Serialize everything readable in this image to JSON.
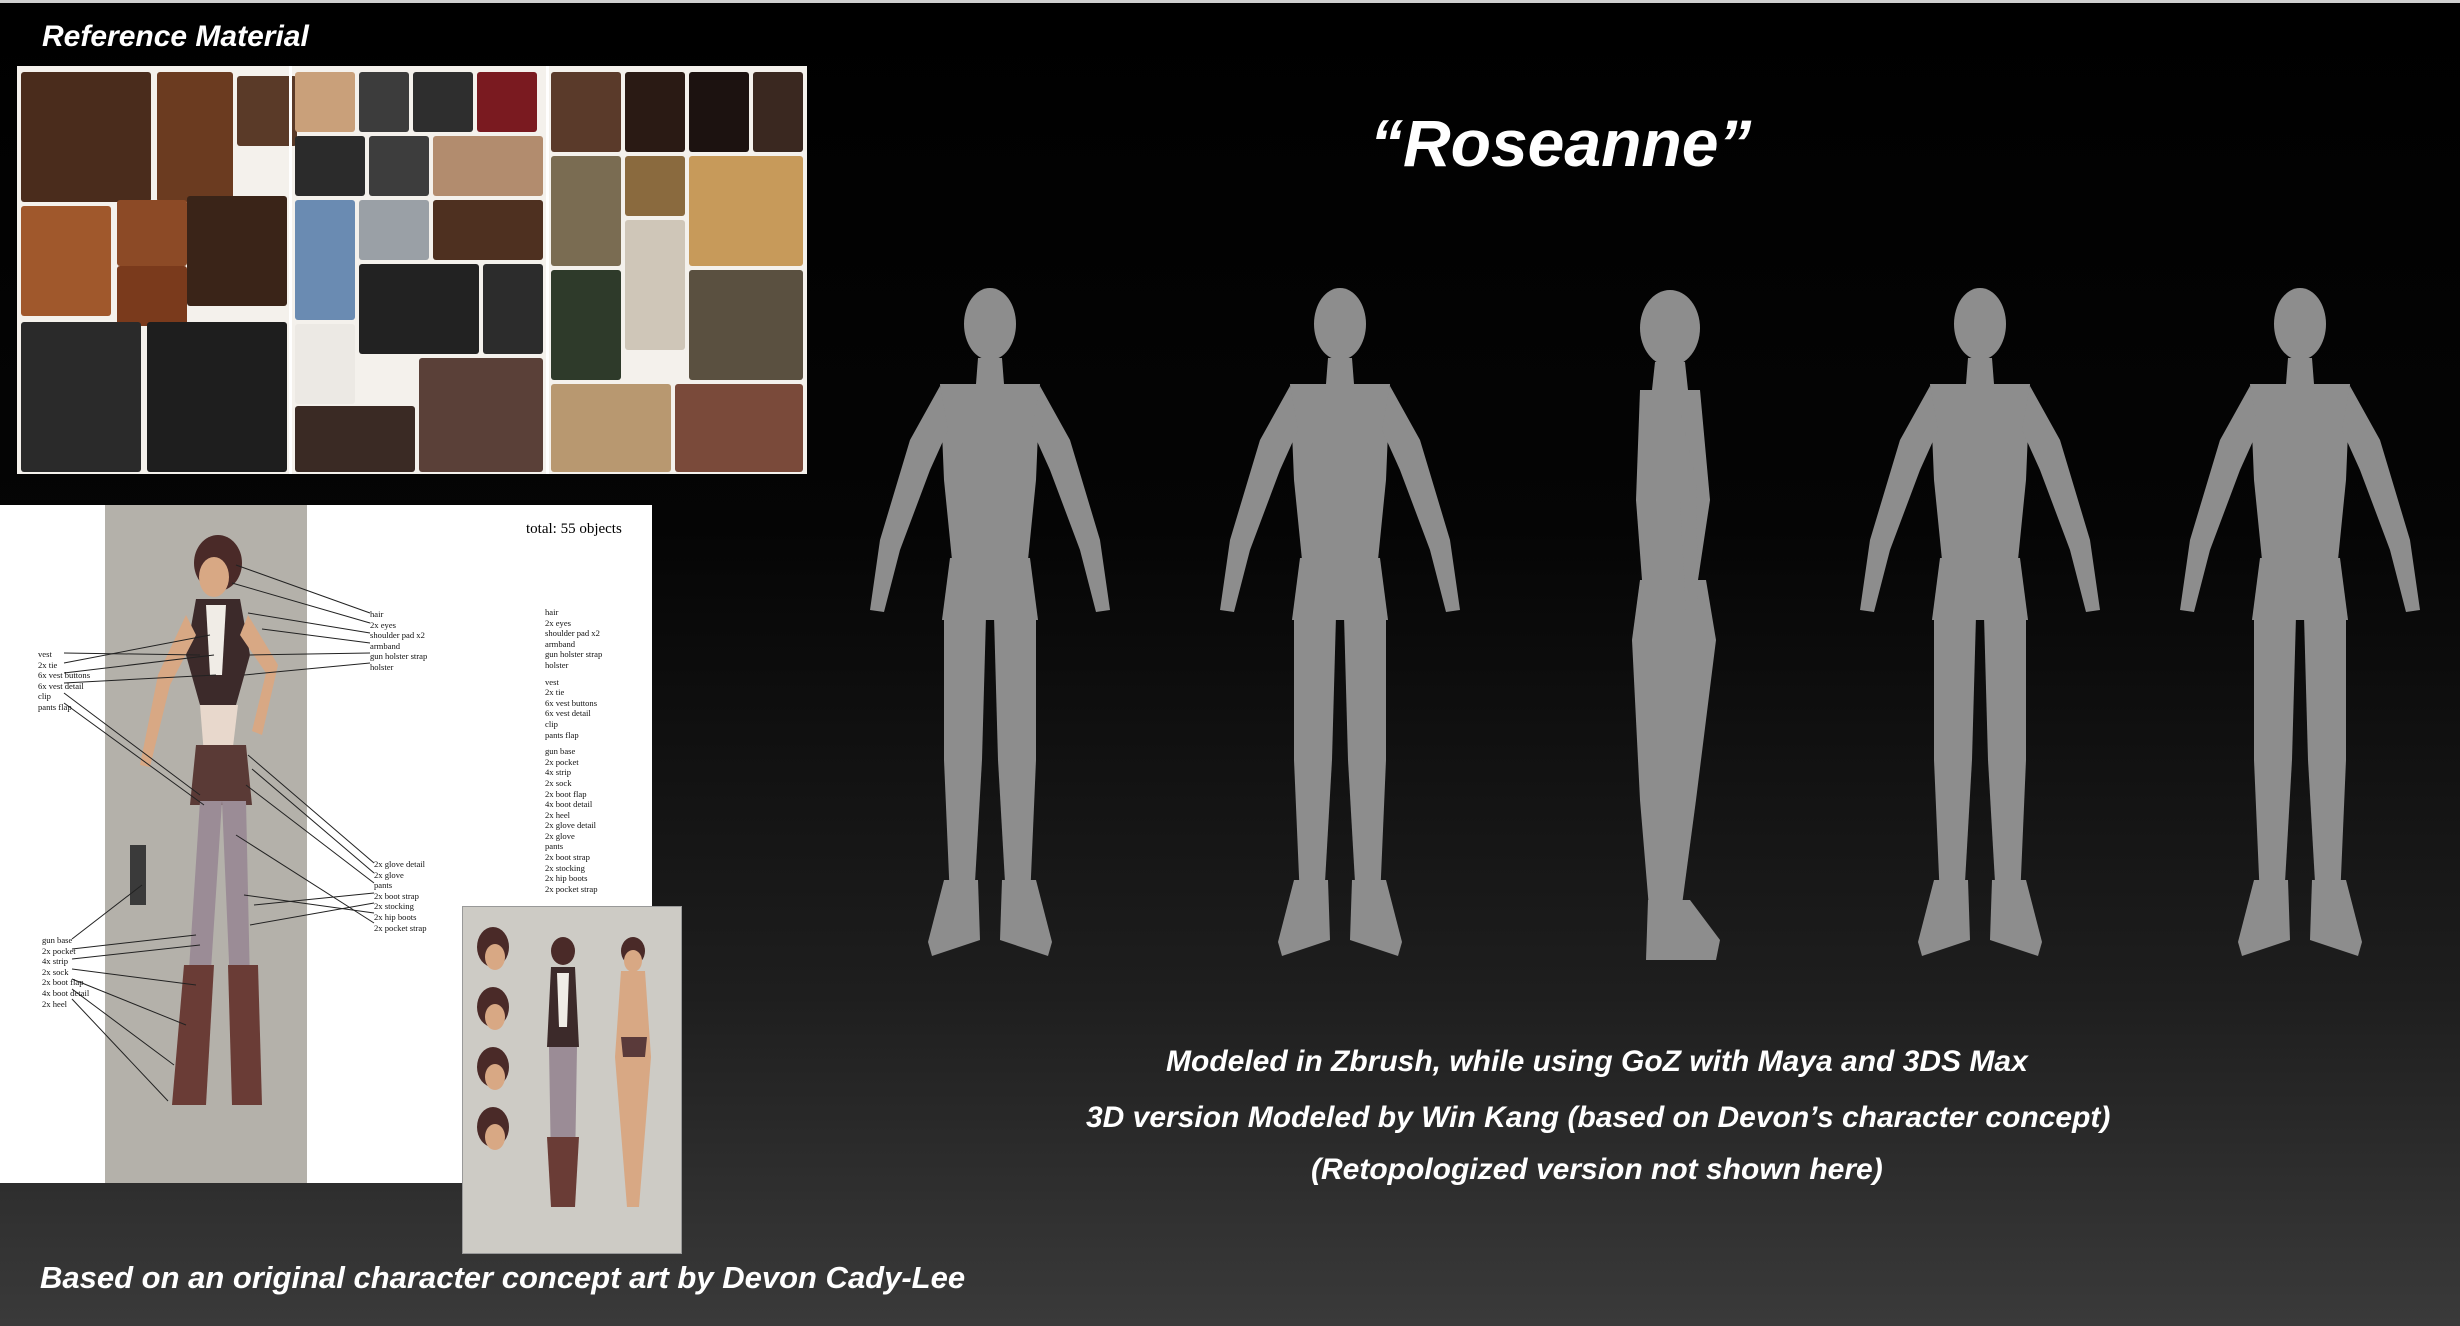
{
  "header": {
    "reference_title": "Reference Material",
    "main_title": "“Roseanne”"
  },
  "concept_sheet": {
    "total": "total: 55 objects",
    "callouts_upper_right": [
      "hair",
      "2x eyes",
      "shoulder pad x2",
      "armband",
      "gun holster strap",
      "holster"
    ],
    "callouts_upper_left": [
      "vest",
      "2x tie",
      "6x vest buttons",
      "6x vest detail",
      "clip",
      "pants flap"
    ],
    "callouts_middle_right": [
      "2x glove detail",
      "2x glove",
      "pants",
      "2x boot strap",
      "2x stocking",
      "2x hip boots",
      "2x pocket strap"
    ],
    "callouts_lower_left": [
      "gun base",
      "2x pocket",
      "4x strip",
      "2x sock",
      "2x boot flap",
      "4x boot detail",
      "2x heel"
    ],
    "object_list": [
      "hair",
      "2x eyes",
      "shoulder pad x2",
      "armband",
      "gun holster strap",
      "holster",
      "",
      "vest",
      "2x tie",
      "6x vest buttons",
      "6x vest detail",
      "clip",
      "pants flap",
      "",
      "gun base",
      "2x pocket",
      "4x strip",
      "2x sock",
      "2x boot flap",
      "4x boot detail",
      "2x heel",
      "2x glove detail",
      "2x glove",
      "pants",
      "2x boot strap",
      "2x stocking",
      "2x hip boots",
      "2x pocket strap"
    ]
  },
  "captions": {
    "line1": "Modeled in Zbrush, while using GoZ with Maya and 3DS Max",
    "line2": "3D version Modeled by Win Kang (based on Devon’s character concept)",
    "line3": "(Retopologized version not shown here)",
    "credit": "Based on an original character concept art by Devon Cady-Lee"
  },
  "colors": {
    "model_gray": "#8d8d8d",
    "collage_background": "#f4f1ec",
    "concept_panel": "#b4b1aa",
    "text": "#ffffff"
  }
}
